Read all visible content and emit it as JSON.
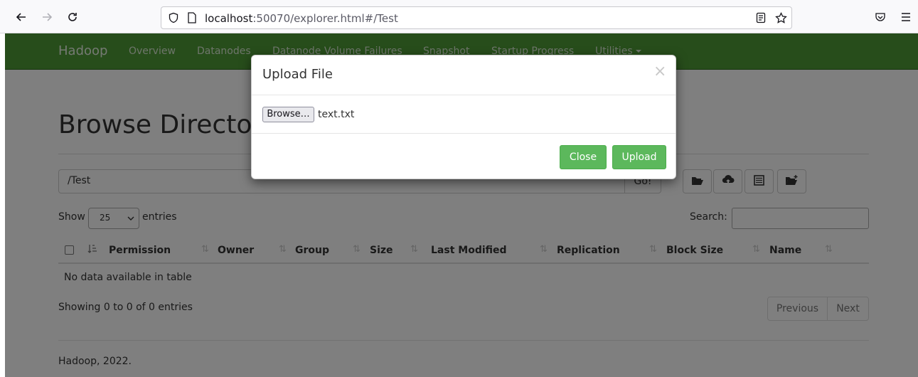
{
  "browser": {
    "url_host": "localhost",
    "url_rest": ":50070/explorer.html#/Test"
  },
  "navbar": {
    "brand": "Hadoop",
    "links": [
      "Overview",
      "Datanodes",
      "Datanode Volume Failures",
      "Snapshot",
      "Startup Progress",
      "Utilities"
    ]
  },
  "main": {
    "title": "Browse Directory",
    "path_value": "/Test",
    "go_label": "Go!",
    "show_label": "Show",
    "entries_select": "25",
    "entries_label": "entries",
    "search_label": "Search:",
    "columns": [
      "Permission",
      "Owner",
      "Group",
      "Size",
      "Last Modified",
      "Replication",
      "Block Size",
      "Name"
    ],
    "empty_message": "No data available in table",
    "showing_text": "Showing 0 to 0 of 0 entries",
    "previous_label": "Previous",
    "next_label": "Next",
    "footer": "Hadoop, 2022."
  },
  "modal": {
    "title": "Upload File",
    "close_x": "×",
    "browse_label": "Browse…",
    "file_name": "text.txt",
    "close_label": "Close",
    "upload_label": "Upload"
  },
  "colors": {
    "navbar": "#4e9a37",
    "success": "#5cb85c"
  }
}
